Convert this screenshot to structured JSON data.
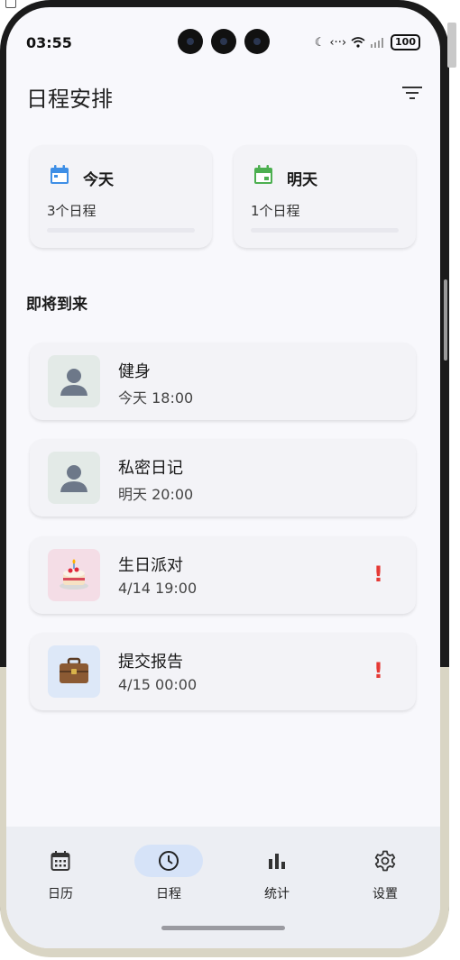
{
  "status_bar": {
    "time": "03:55",
    "battery": "100"
  },
  "header": {
    "title": "日程安排"
  },
  "summary": [
    {
      "title": "今天",
      "count": "3个日程",
      "icon": "calendar-icon",
      "color": "#3d8ee6"
    },
    {
      "title": "明天",
      "count": "1个日程",
      "icon": "calendar-event-icon",
      "color": "#4caf50"
    }
  ],
  "upcoming": {
    "heading": "即将到来",
    "events": [
      {
        "title": "健身",
        "time": "今天 18:00",
        "icon": "person-icon",
        "thumb_color": "#e3eae7",
        "important": false
      },
      {
        "title": "私密日记",
        "time": "明天 20:00",
        "icon": "person-icon",
        "thumb_color": "#e3eae7",
        "important": false
      },
      {
        "title": "生日派对",
        "time": "4/14 19:00",
        "icon": "cake-icon",
        "thumb_color": "#f4dde6",
        "important": true,
        "priority_mark": "!"
      },
      {
        "title": "提交报告",
        "time": "4/15 00:00",
        "icon": "briefcase-icon",
        "thumb_color": "#dde8f8",
        "important": true,
        "priority_mark": "!"
      }
    ]
  },
  "nav": [
    {
      "label": "日历",
      "icon": "calendar-grid-icon",
      "active": false
    },
    {
      "label": "日程",
      "icon": "clock-icon",
      "active": true
    },
    {
      "label": "统计",
      "icon": "bar-chart-icon",
      "active": false
    },
    {
      "label": "设置",
      "icon": "gear-icon",
      "active": false
    }
  ]
}
